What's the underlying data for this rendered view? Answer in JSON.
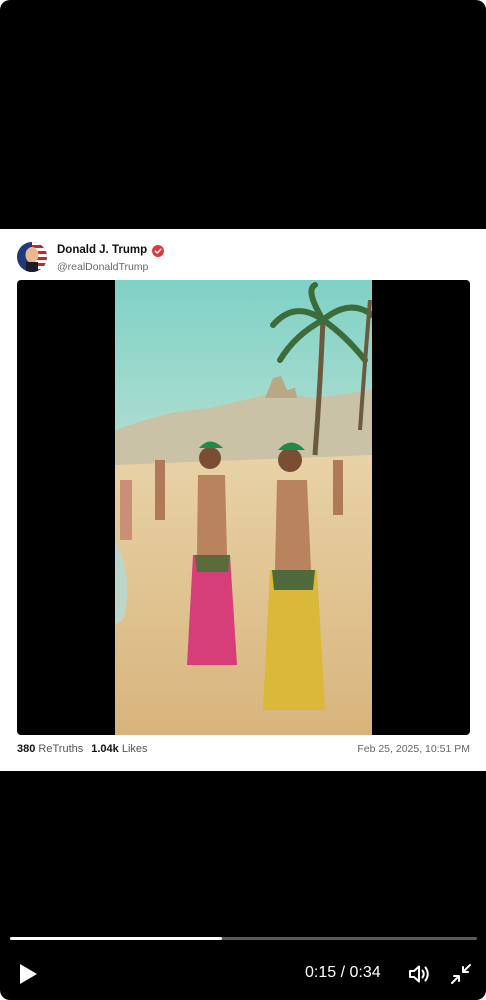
{
  "post": {
    "author_name": "Donald J. Trump",
    "handle": "@realDonaldTrump",
    "retruths_count": "380",
    "retruths_label": "ReTruths",
    "likes_count": "1.04k",
    "likes_label": "Likes",
    "timestamp": "Feb 25, 2025, 10:51 PM",
    "verified_icon": "verified-badge-icon"
  },
  "player": {
    "current_time": "0:15",
    "separator": "/",
    "duration": "0:34",
    "progress_fraction": 0.455,
    "play_icon": "play-icon",
    "volume_icon": "volume-icon",
    "minimize_icon": "minimize-icon"
  },
  "colors": {
    "background": "#000000",
    "card": "#ffffff",
    "verified": "#e0383e",
    "progress_fill": "#ffffff",
    "progress_track": "#5a5a5a"
  }
}
